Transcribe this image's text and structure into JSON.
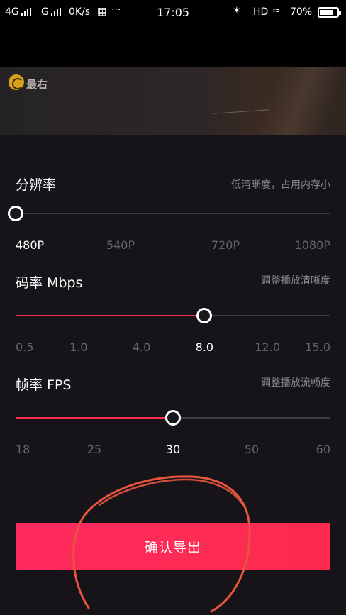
{
  "status_bar": {
    "network1": "4G",
    "network2": "G",
    "speed": "0K/s",
    "more": "···",
    "time": "17:05",
    "hd": "HD",
    "battery": "70%",
    "battery_level": 0.7
  },
  "preview": {
    "logo_text": "最右"
  },
  "resolution": {
    "title": "分辨率",
    "hint": "低清晰度，占用内存小",
    "options": [
      "480P",
      "540P",
      "720P",
      "1080P"
    ],
    "selected": "480P"
  },
  "bitrate": {
    "title": "码率 Mbps",
    "hint": "调整播放清晰度",
    "options": [
      "0.5",
      "1.0",
      "4.0",
      "8.0",
      "12.0",
      "15.0"
    ],
    "selected": "8.0"
  },
  "framerate": {
    "title": "帧率 FPS",
    "hint": "调整播放流畅度",
    "options": [
      "18",
      "25",
      "30",
      "50",
      "60"
    ],
    "selected": "30"
  },
  "confirm_label": "确认导出",
  "colors": {
    "accent": "#fe2c55",
    "track": "#3e3c42",
    "panel": "#161418",
    "annotation": "#e8553f"
  }
}
